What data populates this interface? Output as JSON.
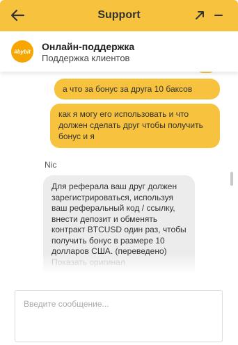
{
  "header": {
    "title": "Support",
    "back_icon": "arrow-left-icon",
    "expand_icon": "arrow-up-right-icon",
    "minimize_icon": "minus-icon",
    "background_color": "#f7c33e"
  },
  "agent": {
    "avatar_text": "#bybit",
    "name": "Онлайн-поддержка",
    "subtitle": "Поддержка клиентов",
    "avatar_color": "#f7a600"
  },
  "messages": [
    {
      "direction": "outgoing",
      "text": "а что за бонус за друга 10 баксов"
    },
    {
      "direction": "outgoing",
      "text": "как я могу его использовать и что должен сделать друг чтобы получить бонус и я"
    },
    {
      "direction": "incoming",
      "sender": "Nic",
      "text": "Для реферала ваш друг должен зарегистрироваться, используя ваш реферальный код / ссылку, внести депозит и обменять контракт BTCUSD один раз, чтобы получить бонус в размере 10 долларов США. (переведено)",
      "more_link": "Показать оригинал"
    }
  ],
  "composer": {
    "placeholder": "Введите сообщение..."
  }
}
